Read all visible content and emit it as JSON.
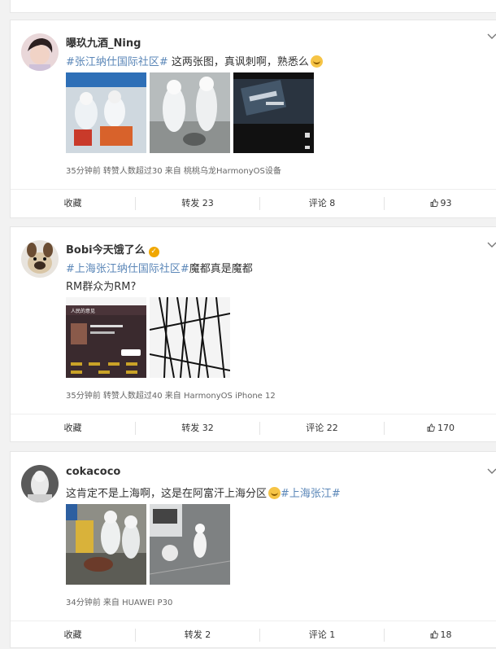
{
  "posts": [
    {
      "username": "曝玖九酒_Ning",
      "content": {
        "tag": "#张江纳仕国际社区#",
        "text": " 这两张图，真讽刺啊，熟悉么"
      },
      "meta": "35分钟前  转赞人数超过30  来自 桃桃乌龙HarmonyOS设备",
      "actions": {
        "fav": "收藏",
        "repost": "转发 23",
        "comment": "评论 8",
        "like": "93"
      }
    },
    {
      "username": "Bobi今天饿了么",
      "verified": "✓",
      "content": {
        "tag": "#上海张江纳仕国际社区#",
        "text": "魔都真是魔都",
        "line2": "RM群众为RM?"
      },
      "screenshot_header": "人民的意见",
      "meta": "35分钟前  转赞人数超过40  来自 HarmonyOS iPhone 12",
      "actions": {
        "fav": "收藏",
        "repost": "转发 32",
        "comment": "评论 22",
        "like": "170"
      }
    },
    {
      "username": "cokacoco",
      "content": {
        "text": "这肯定不是上海啊，这是在阿富汗上海分区",
        "tag": "#上海张江#"
      },
      "meta": "34分钟前  来自 HUAWEI P30",
      "actions": {
        "fav": "收藏",
        "repost": "转发 2",
        "comment": "评论 1",
        "like": "18"
      }
    }
  ],
  "colors": {
    "topic_link": "#5b87b8",
    "background": "#f2f2f2"
  },
  "icons": {
    "more": "chevron-down-icon",
    "like": "thumbs-up-icon",
    "emoji": "emoji-icon"
  }
}
